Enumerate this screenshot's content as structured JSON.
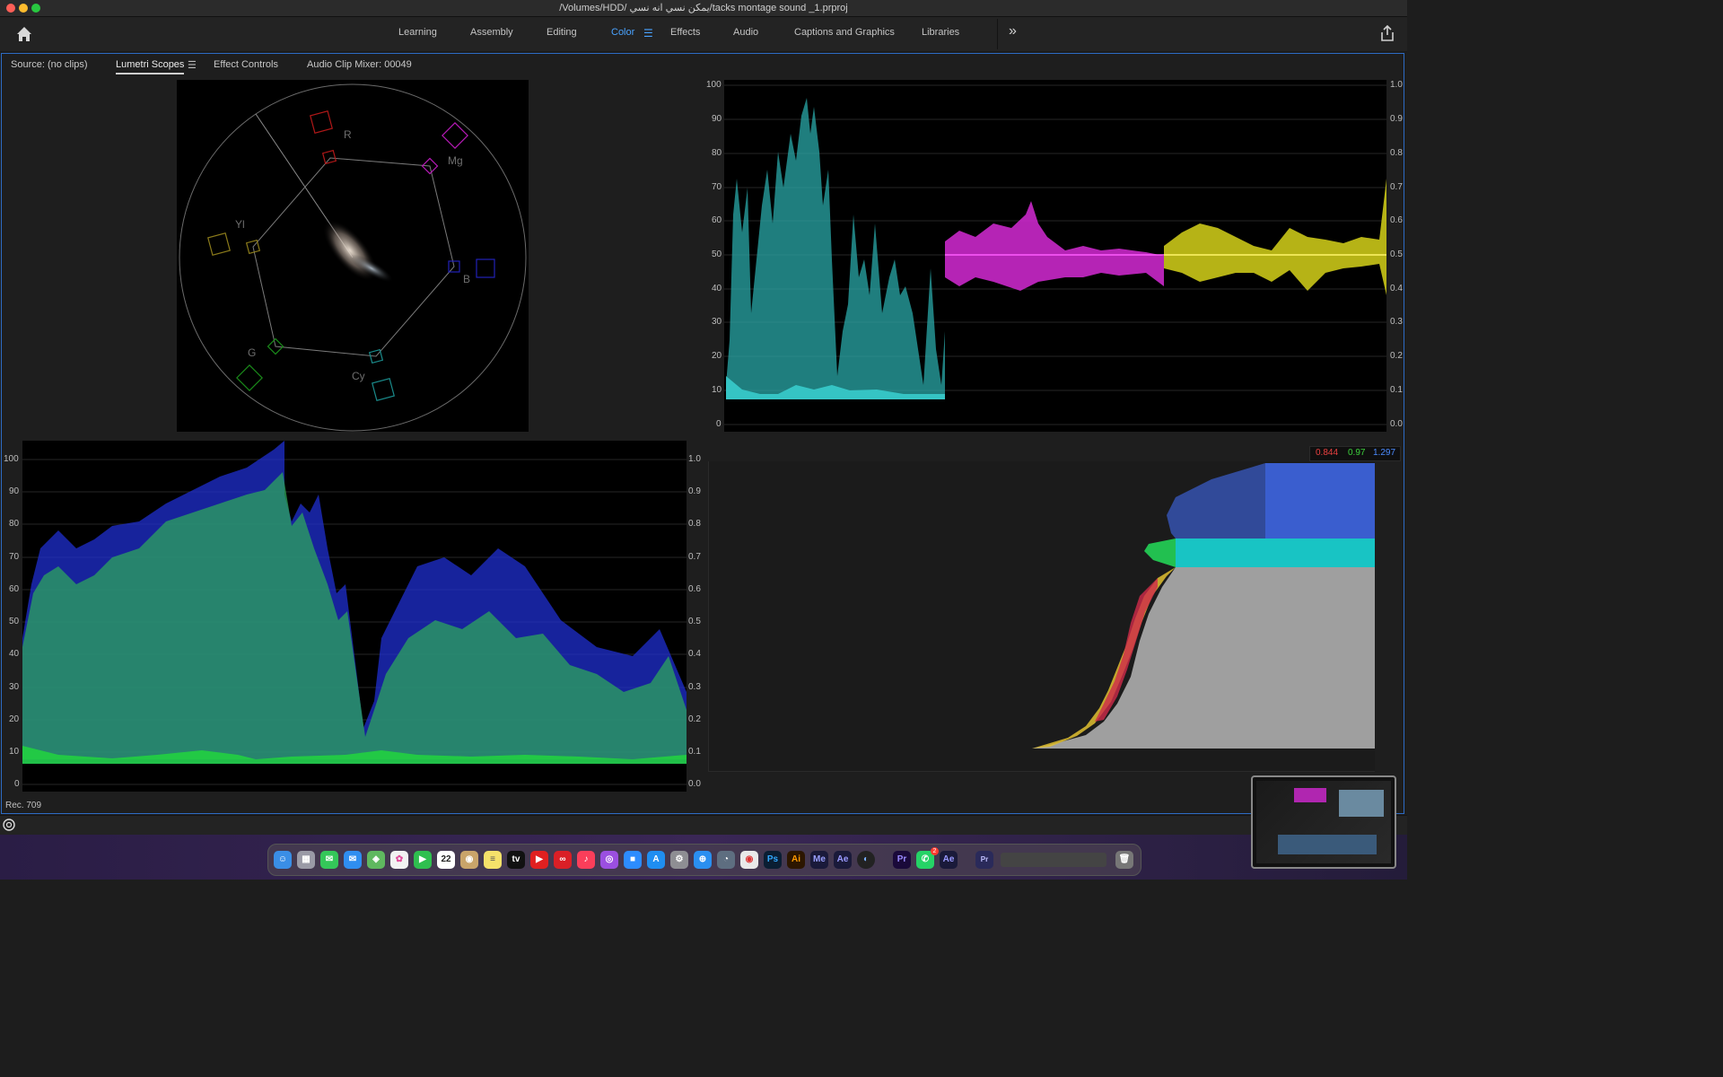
{
  "window": {
    "title": "/Volumes/HDD/ يمكن نسي  انه نسي/tacks montage sound _1.prproj"
  },
  "workspaces": [
    {
      "label": "Learning",
      "active": false
    },
    {
      "label": "Assembly",
      "active": false
    },
    {
      "label": "Editing",
      "active": false
    },
    {
      "label": "Color",
      "active": true
    },
    {
      "label": "Effects",
      "active": false
    },
    {
      "label": "Audio",
      "active": false
    },
    {
      "label": "Captions and Graphics",
      "active": false
    },
    {
      "label": "Libraries",
      "active": false
    }
  ],
  "workspace_menu_icon": "hamburger-icon",
  "more_icon": "double-chevron-right-icon",
  "panel_tabs": [
    {
      "label": "Source: (no clips)",
      "active": false
    },
    {
      "label": "Lumetri Scopes",
      "active": true
    },
    {
      "label": "Effect Controls",
      "active": false
    },
    {
      "label": "Audio Clip Mixer: 00049",
      "active": false
    }
  ],
  "vectorscope": {
    "labels": [
      "R",
      "Mg",
      "B",
      "Cy",
      "G",
      "Yl"
    ]
  },
  "parade_axis": {
    "left": [
      "100",
      "90",
      "80",
      "70",
      "60",
      "50",
      "40",
      "30",
      "20",
      "10",
      "0"
    ],
    "right": [
      "1.0",
      "0.9",
      "0.8",
      "0.7",
      "0.6",
      "0.5",
      "0.4",
      "0.3",
      "0.2",
      "0.1",
      "0.0"
    ]
  },
  "waveform_axis": {
    "left": [
      "100",
      "90",
      "80",
      "70",
      "60",
      "50",
      "40",
      "30",
      "20",
      "10",
      "0"
    ],
    "right": [
      "1.0",
      "0.9",
      "0.8",
      "0.7",
      "0.6",
      "0.5",
      "0.4",
      "0.3",
      "0.2",
      "0.1",
      "0.0"
    ]
  },
  "histogram": {
    "readout_r": "0.844",
    "readout_g": "0.97",
    "readout_b": "1.297"
  },
  "status": {
    "color_space": "Rec. 709"
  },
  "colors": {
    "accent": "#4aa3ff",
    "panel_border": "#2d6bc4"
  },
  "dock": {
    "calendar_day": "22",
    "whatsapp_badge": "2",
    "apps": [
      "Finder",
      "Launchpad",
      "Messages",
      "Mail",
      "Maps",
      "Photos",
      "FaceTime",
      "Calendar",
      "Contacts",
      "Notes",
      "TV",
      "YouTube",
      "Creative Cloud",
      "Music",
      "Podcasts",
      "Zoom",
      "App Store",
      "System Settings",
      "Safari",
      "Find",
      "Chrome",
      "Ps",
      "Ai",
      "Me",
      "Ae",
      "Cinema 4D",
      "Pr",
      "WhatsApp",
      "Ae",
      "Pr Proj"
    ]
  }
}
